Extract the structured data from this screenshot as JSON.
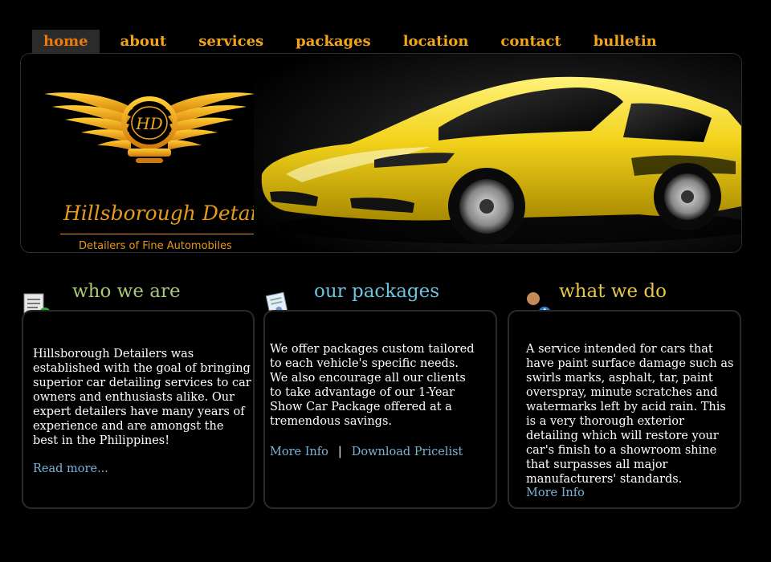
{
  "nav": {
    "items": [
      {
        "label": "home",
        "active": true
      },
      {
        "label": "about"
      },
      {
        "label": "services"
      },
      {
        "label": "packages"
      },
      {
        "label": "location"
      },
      {
        "label": "contact"
      },
      {
        "label": "bulletin"
      }
    ]
  },
  "banner": {
    "logo_monogram": "HD",
    "brand_name": "Hillsborough Detailers",
    "tagline": "Detailers of Fine  Automobiles"
  },
  "sections": {
    "who": {
      "title": "who we are",
      "title_color": "#a8c77a",
      "icon": "document-add-icon",
      "text": "Hillsborough Detailers was established with the goal of bringing superior car detailing services to car owners and enthusiasts alike. Our expert detailers have many years of experience and are amongst the best in the Philippines!",
      "link": "Read more..."
    },
    "packages": {
      "title": "our packages",
      "title_color": "#6fc3df",
      "icon": "certificate-document-icon",
      "text": "We offer packages custom tailored to each vehicle's specific needs. We also encourage all our clients to take advantage of our 1-Year Show Car Package offered at a tremendous savings.",
      "link_more": "More Info",
      "separator": "|",
      "link_download": "Download Pricelist"
    },
    "what": {
      "title": "what we do",
      "title_color": "#e7c84a",
      "icon": "user-info-icon",
      "text": "A service intended for cars that have paint surface damage such as swirls marks, asphalt, tar, paint overspray, minute scratches and watermarks left by acid rain. This is a very thorough exterior detailing which will restore your car's finish to a showroom shine that surpasses all major manufacturers' standards.",
      "link": "More Info"
    }
  },
  "colors": {
    "nav_text": "#f3a51a",
    "nav_active_text": "#ee7a0c",
    "brand_gold": "#e69a1c",
    "link": "#7ab4d8"
  }
}
